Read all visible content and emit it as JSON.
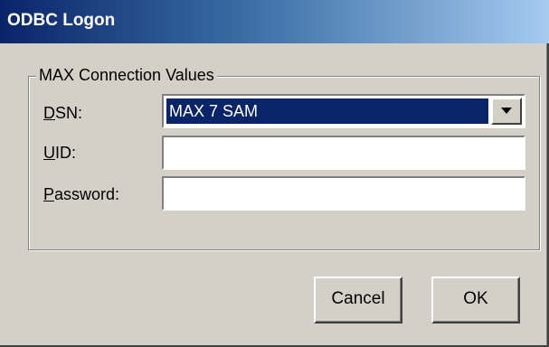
{
  "window": {
    "title": "ODBC Logon"
  },
  "group": {
    "legend": "MAX Connection Values"
  },
  "fields": {
    "dsn": {
      "mnemonic": "D",
      "label_rest": "SN:",
      "value": "MAX 7 SAM"
    },
    "uid": {
      "mnemonic": "U",
      "label_rest": "ID:",
      "value": ""
    },
    "password": {
      "mnemonic": "P",
      "label_rest": "assword:",
      "value": ""
    }
  },
  "buttons": {
    "cancel": "Cancel",
    "ok": "OK"
  },
  "icons": {
    "dropdown": "chevron-down-icon"
  },
  "colors": {
    "title_gradient_start": "#0a246a",
    "title_gradient_end": "#a6caf0",
    "dialog_face": "#d4d0c8",
    "selection": "#0a246a"
  }
}
